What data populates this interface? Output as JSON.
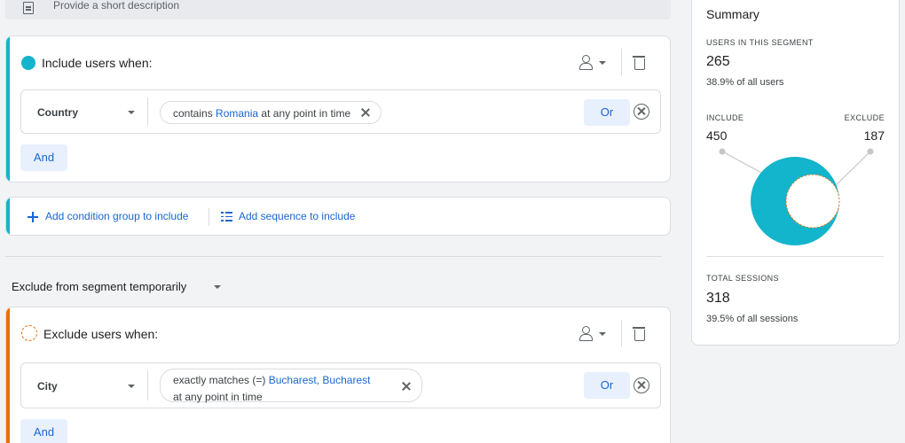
{
  "description": {
    "placeholder": "Provide a short description"
  },
  "include_card": {
    "title": "Include users when:",
    "condition": {
      "dimension": "Country",
      "prefix": "contains",
      "value": "Romania",
      "suffix": "at any point in time"
    },
    "or_label": "Or",
    "and_label": "And"
  },
  "add_actions": {
    "add_group": "Add condition group to include",
    "add_sequence": "Add sequence to include"
  },
  "exclude_toggle": {
    "label": "Exclude from segment temporarily"
  },
  "exclude_card": {
    "title": "Exclude users when:",
    "condition": {
      "dimension": "City",
      "prefix": "exactly matches (=)",
      "value": "Bucharest, Bucharest",
      "suffix": "at any point in time"
    },
    "or_label": "Or",
    "and_label": "And"
  },
  "summary": {
    "title": "Summary",
    "users_caption": "USERS IN THIS SEGMENT",
    "users_value": "265",
    "users_sub": "38.9% of all users",
    "include_caption": "INCLUDE",
    "include_value": "450",
    "exclude_caption": "EXCLUDE",
    "exclude_value": "187",
    "sessions_caption": "TOTAL SESSIONS",
    "sessions_value": "318",
    "sessions_sub": "39.5% of all sessions"
  },
  "colors": {
    "include_accent": "#12b5cb",
    "exclude_accent": "#e8710a",
    "link_blue": "#1967d2",
    "button_bg": "#e8f0fe"
  },
  "icons": [
    "description-icon",
    "person-icon",
    "chevron-down-icon",
    "trash-icon",
    "close-icon",
    "remove-circle-icon",
    "plus-icon",
    "sequence-icon"
  ]
}
